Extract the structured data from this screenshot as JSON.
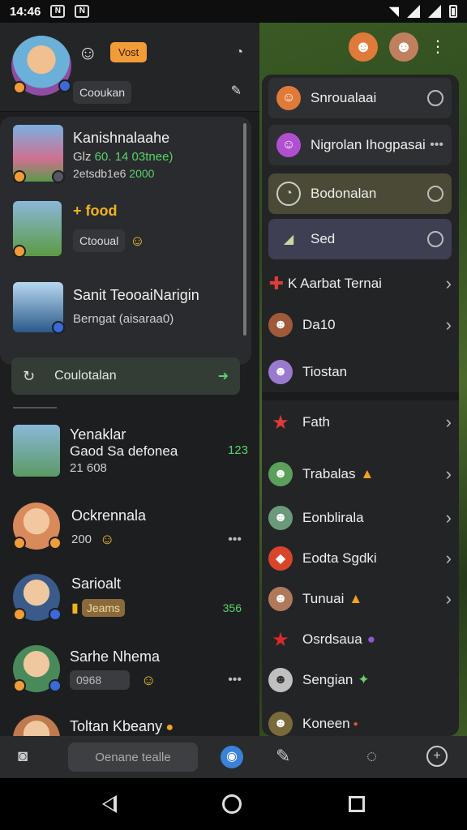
{
  "status_bar": {
    "time": "14:46"
  },
  "profile": {
    "orange_tag": "Vost",
    "chip": "Cooukan"
  },
  "conversations_top": [
    {
      "title": "Kanishnalaahe",
      "line1_a": "Glz",
      "line1_b": "60. 14 03tnee)",
      "line2_a": "2etsdb1e6",
      "line2_b": "2000",
      "thumb_color": "#5fa0d8"
    },
    {
      "title": "+ food",
      "chip": "Ctooual",
      "thumb_color": "#5c9a44"
    },
    {
      "title": "Sanit TeooaiNarigin",
      "line1": "Berngat (aisaraa0)",
      "thumb_color": "#6a9fcc"
    }
  ],
  "recent_button": {
    "label": "Coulotalan"
  },
  "conversations_bottom": [
    {
      "title": "Yenaklar",
      "line1": "Gaod Sa defonea",
      "line2": "21 608",
      "count": "123",
      "thumb_color": "#5a9a64"
    },
    {
      "title": "Ockrennala",
      "line1": "200",
      "dots": "•••",
      "thumb_color": "#d98a5a"
    },
    {
      "title": "Sarioalt",
      "chip": "Jeams",
      "count": "356",
      "thumb_color": "#3a5a8a"
    },
    {
      "title": "Sarhe Nhema",
      "chip": "0968",
      "dots": "•••",
      "thumb_color": "#4a8a5a"
    },
    {
      "title": "Toltan Kbeany",
      "thumb_color": "#c07a50"
    }
  ],
  "bottom_nav": {
    "search_placeholder": "Oenane tealle"
  },
  "menu": {
    "boxed_items": [
      {
        "label": "Snroualaai",
        "bg": "#2f3033",
        "icon": "☺",
        "icon_bg": "#e07a3a",
        "end": "circle"
      },
      {
        "label": "Nigrolan Ihogpasai",
        "bg": "#2f3033",
        "icon": "☺",
        "icon_bg": "#b04fcf",
        "end": "•••"
      },
      {
        "label": "Bodonalan",
        "bg": "#4a4a36",
        "icon": "◔",
        "icon_bg": "transparent",
        "end": "circle"
      },
      {
        "label": "Sed",
        "bg": "#3e3f52",
        "icon": "◢",
        "icon_bg": "transparent",
        "end": "circle"
      }
    ],
    "items": [
      {
        "label": "K Aarbat Ternai",
        "icon": "✚",
        "icon_bg": "transparent",
        "icon_color": "#e03a3a",
        "end": "›"
      },
      {
        "label": "Da10",
        "icon": "☻",
        "icon_bg": "#a05a3a",
        "icon_color": "#fff",
        "end": "›"
      },
      {
        "label": "Tiostan",
        "icon": "☻",
        "icon_bg": "#9a7ad0",
        "icon_color": "#fff",
        "end": ""
      },
      {
        "label": "Fath",
        "icon": "★",
        "icon_bg": "transparent",
        "icon_color": "#e03a3a",
        "end": "›"
      },
      {
        "label": "Trabalas",
        "icon": "☻",
        "icon_bg": "#5aa05a",
        "icon_color": "#fff",
        "end": "›"
      },
      {
        "label": "Eonblirala",
        "icon": "☻",
        "icon_bg": "#6a9a7a",
        "icon_color": "#fff",
        "end": "›"
      },
      {
        "label": "Eodta Sgdki",
        "icon": "◆",
        "icon_bg": "#d8452a",
        "icon_color": "#fff",
        "end": "›"
      },
      {
        "label": "Tunuai",
        "icon": "☻",
        "icon_bg": "#b07a5a",
        "icon_color": "#fff",
        "end": "›"
      },
      {
        "label": "Osrdsaua",
        "icon": "★",
        "icon_bg": "transparent",
        "icon_color": "#d82a2a",
        "end": ""
      },
      {
        "label": "Sengian",
        "icon": "☻",
        "icon_bg": "#c0c0c0",
        "icon_color": "#333",
        "end": ""
      },
      {
        "label": "Koneen",
        "icon": "☻",
        "icon_bg": "#7a6a3a",
        "icon_color": "#fff",
        "end": ""
      }
    ]
  }
}
